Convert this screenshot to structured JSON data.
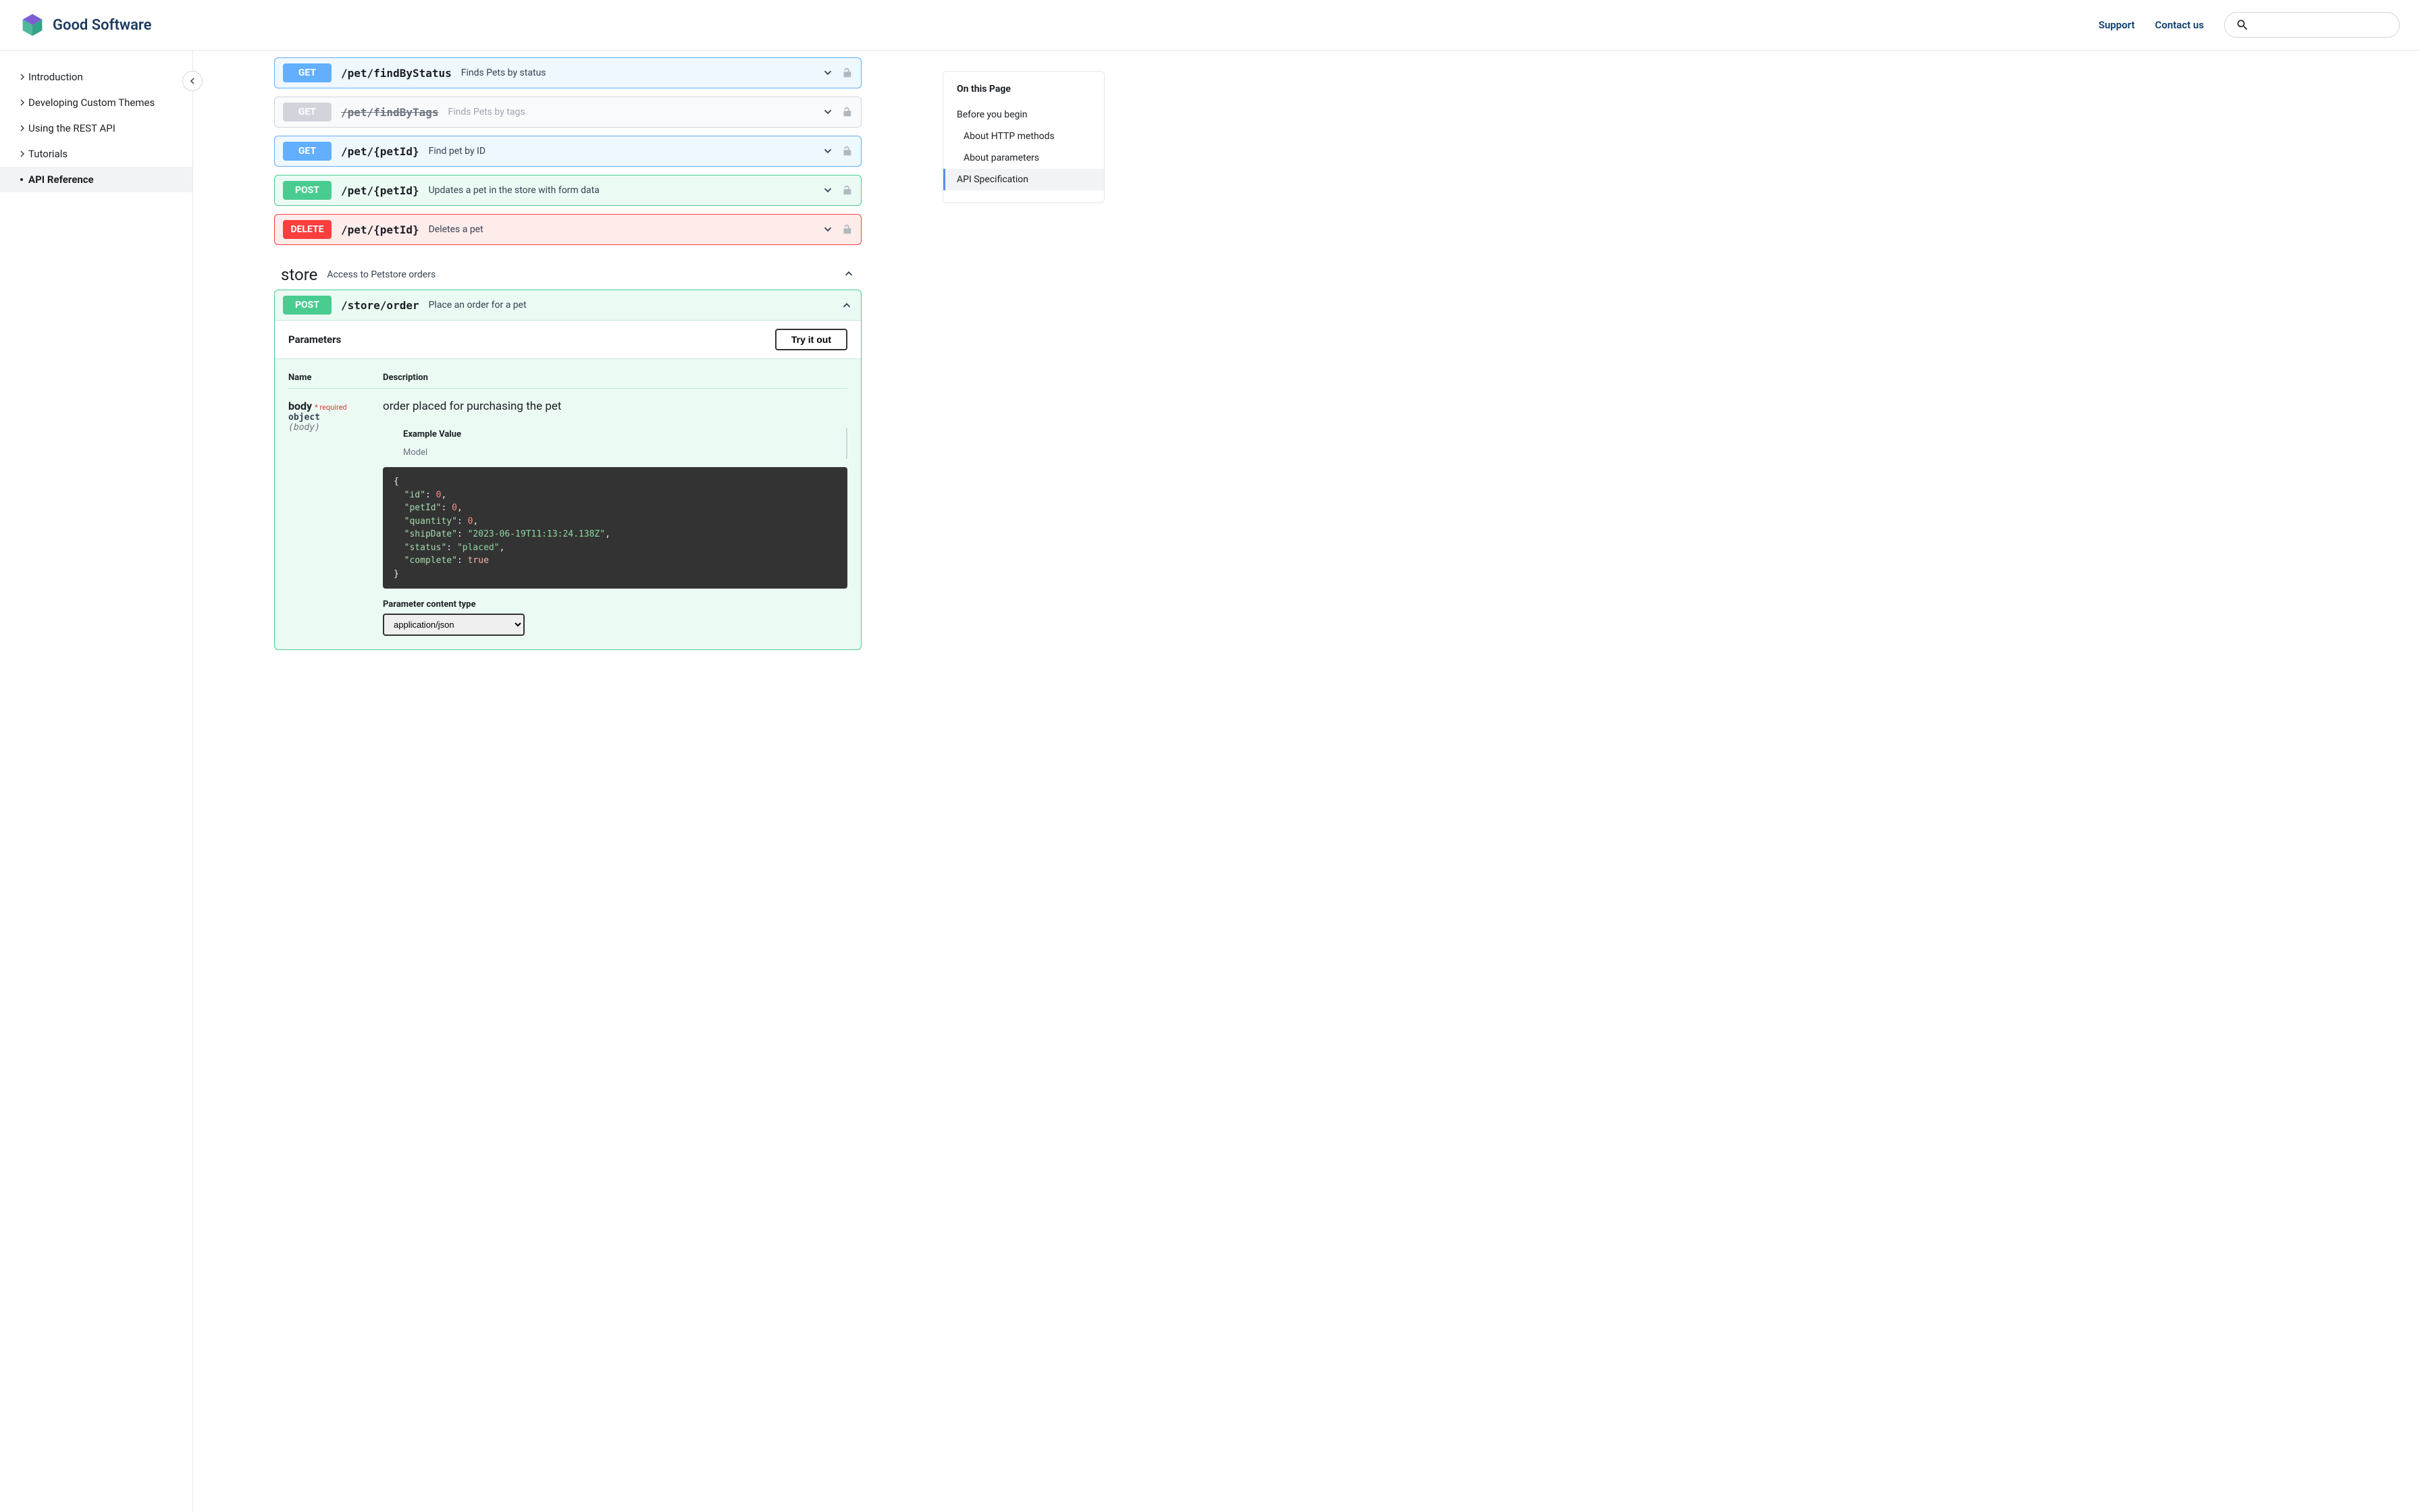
{
  "brand": "Good Software",
  "header_nav": {
    "support": "Support",
    "contact": "Contact us"
  },
  "sidebar": {
    "items": [
      {
        "label": "Introduction",
        "expandable": true
      },
      {
        "label": "Developing Custom Themes",
        "expandable": true
      },
      {
        "label": "Using the REST API",
        "expandable": true
      },
      {
        "label": "Tutorials",
        "expandable": true
      },
      {
        "label": "API Reference",
        "expandable": false,
        "active": true
      }
    ]
  },
  "endpoints": [
    {
      "method": "GET",
      "path": "/pet/findByStatus",
      "desc": "Finds Pets by status",
      "class": "get"
    },
    {
      "method": "GET",
      "path": "/pet/findByTags",
      "desc": "Finds Pets by tags",
      "class": "get-deprecated"
    },
    {
      "method": "GET",
      "path": "/pet/{petId}",
      "desc": "Find pet by ID",
      "class": "get"
    },
    {
      "method": "POST",
      "path": "/pet/{petId}",
      "desc": "Updates a pet in the store with form data",
      "class": "post"
    },
    {
      "method": "DELETE",
      "path": "/pet/{petId}",
      "desc": "Deletes a pet",
      "class": "delete"
    }
  ],
  "section": {
    "name": "store",
    "desc": "Access to Petstore orders"
  },
  "expanded": {
    "method": "POST",
    "path": "/store/order",
    "desc": "Place an order for a pet",
    "params_label": "Parameters",
    "try_label": "Try it out",
    "col_name": "Name",
    "col_desc": "Description",
    "param_name": "body",
    "param_req": "* required",
    "param_type": "object",
    "param_in": "(body)",
    "param_desc": "order placed for purchasing the pet",
    "tab_example": "Example Value",
    "tab_model": "Model",
    "content_type_label": "Parameter content type",
    "content_type_value": "application/json",
    "code": {
      "id": 0,
      "petId": 0,
      "quantity": 0,
      "shipDate": "2023-06-19T11:13:24.138Z",
      "status": "placed",
      "complete": true
    }
  },
  "toc": {
    "title": "On this Page",
    "items": [
      {
        "label": "Before you begin",
        "sub": false
      },
      {
        "label": "About HTTP methods",
        "sub": true
      },
      {
        "label": "About parameters",
        "sub": true
      },
      {
        "label": "API Specification",
        "sub": false,
        "active": true
      }
    ]
  }
}
